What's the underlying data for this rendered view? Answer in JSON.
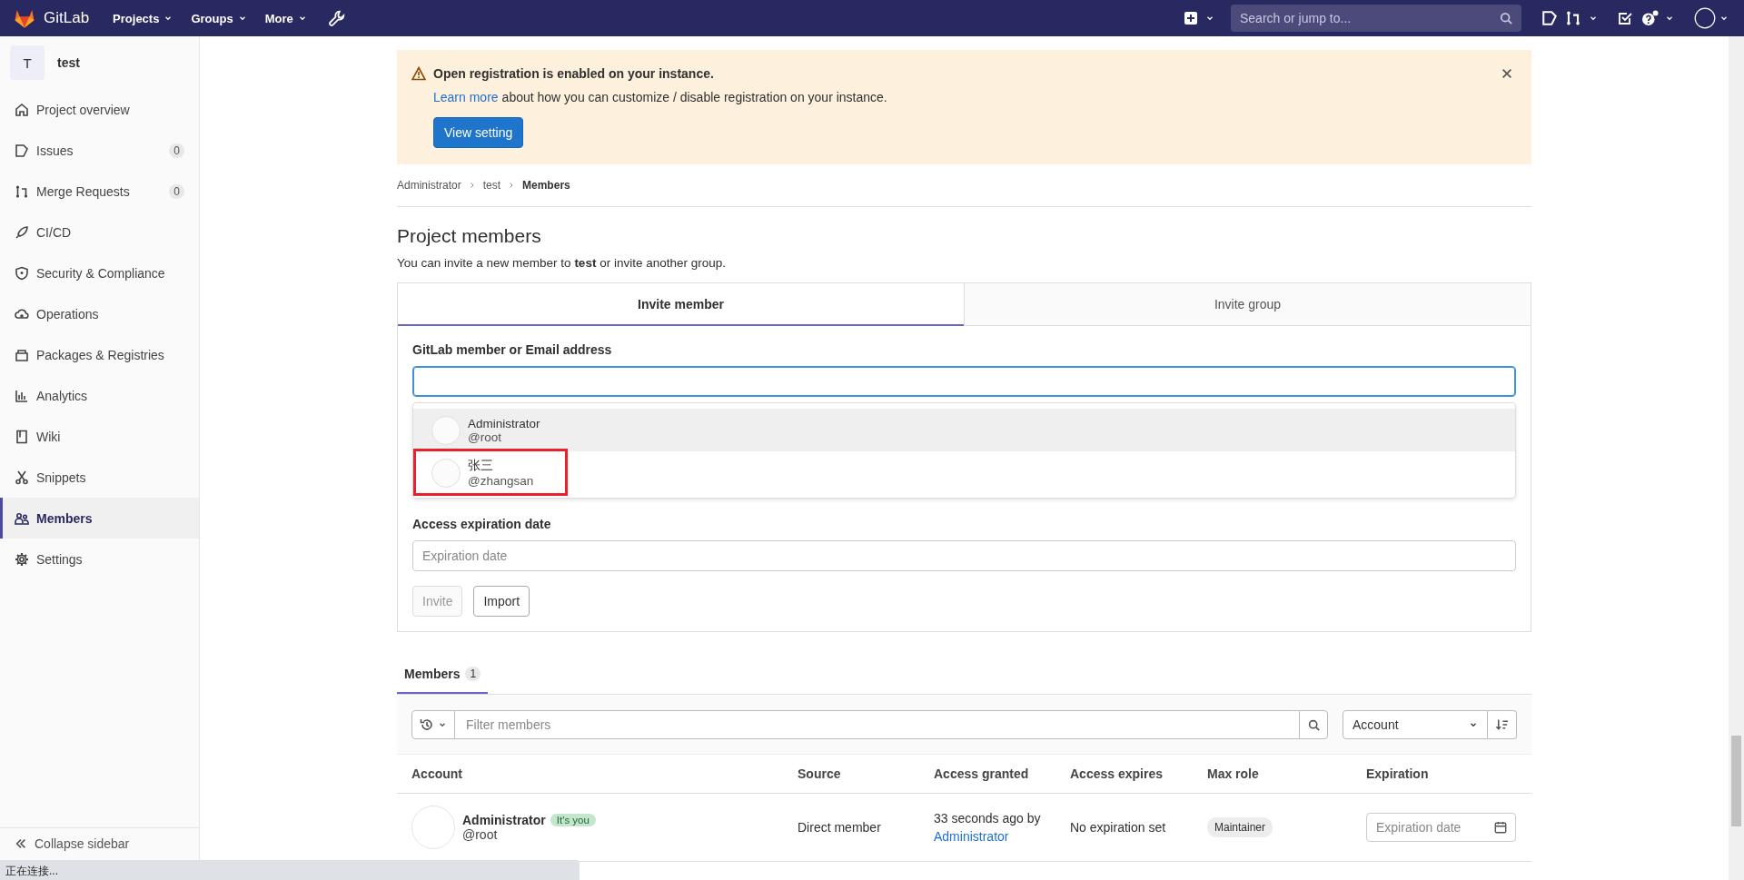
{
  "top_bar": {
    "brand": "GitLab",
    "nav": [
      {
        "label": "Projects"
      },
      {
        "label": "Groups"
      },
      {
        "label": "More"
      }
    ],
    "search": {
      "placeholder": "Search or jump to..."
    }
  },
  "sidebar": {
    "project": {
      "initial": "T",
      "name": "test"
    },
    "items": [
      {
        "label": "Project overview",
        "selected": false
      },
      {
        "label": "Issues",
        "count": "0",
        "selected": false
      },
      {
        "label": "Merge Requests",
        "count": "0",
        "selected": false
      },
      {
        "label": "CI/CD",
        "selected": false
      },
      {
        "label": "Security & Compliance",
        "selected": false
      },
      {
        "label": "Operations",
        "selected": false
      },
      {
        "label": "Packages & Registries",
        "selected": false
      },
      {
        "label": "Analytics",
        "selected": false
      },
      {
        "label": "Wiki",
        "selected": false
      },
      {
        "label": "Snippets",
        "selected": false
      },
      {
        "label": "Members",
        "selected": true
      },
      {
        "label": "Settings",
        "selected": false
      }
    ],
    "collapse": "Collapse sidebar"
  },
  "alert": {
    "title": "Open registration is enabled on your instance.",
    "link": "Learn more",
    "text": "about how you can customize / disable registration on your instance.",
    "button": "View setting"
  },
  "breadcrumb": [
    {
      "label": "Administrator",
      "current": false
    },
    {
      "label": "test",
      "current": false
    },
    {
      "label": "Members",
      "current": true
    }
  ],
  "heading": "Project members",
  "description": "You can invite a new member to **test** or invite another group.",
  "invite_tabs": [
    {
      "label": "Invite member",
      "selected": true
    },
    {
      "label": "Invite group",
      "selected": false
    }
  ],
  "invite_form": {
    "member_label": "GitLab member or Email address",
    "suggestions": [
      {
        "name": "Administrator",
        "username": "@root",
        "highlighted": true,
        "marked": false
      },
      {
        "name": "张三",
        "username": "@zhangsan",
        "highlighted": false,
        "marked": true
      }
    ],
    "expiration_label": "Access expiration date",
    "expiration_placeholder": "Expiration date",
    "buttons": [
      {
        "label": "Invite",
        "disabled": true
      },
      {
        "label": "Import",
        "disabled": false
      }
    ]
  },
  "member_tabs": [
    {
      "label": "Members",
      "count": "1",
      "selected": true
    }
  ],
  "filter": {
    "placeholder": "Filter members",
    "sort": "Account"
  },
  "table": {
    "columns": [
      "Account",
      "Source",
      "Access granted",
      "Access expires",
      "Max role",
      "Expiration"
    ],
    "rows": [
      {
        "name": "Administrator",
        "badge": "It's you",
        "username": "@root",
        "source": "Direct member",
        "granted": "33 seconds ago by",
        "granted_by": "Administrator",
        "expires": "No expiration set",
        "max_role": "Maintainer",
        "expiration_placeholder": "Expiration date"
      }
    ]
  },
  "status_bubble": "正在连接..."
}
